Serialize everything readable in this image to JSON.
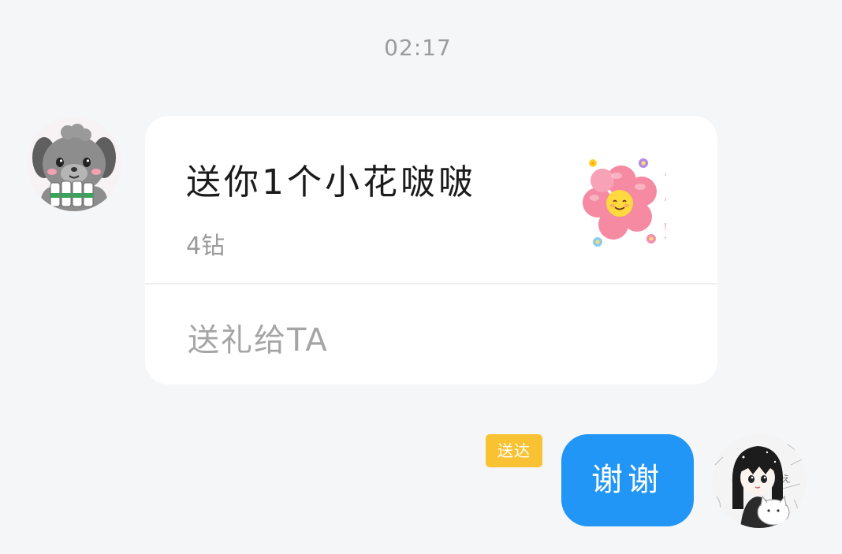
{
  "chat": {
    "timestamp": "02:17",
    "received_message": {
      "sender_avatar": "gray-puppy-avatar",
      "gift_card": {
        "title": "送你1个小花啵啵",
        "price": "4钻",
        "gift_image": "pink-flower-sticker",
        "gift_image_text": "棒棒！",
        "action_label": "送礼给TA"
      }
    },
    "sent_message": {
      "status_badge": "送达",
      "text": "谢谢",
      "sender_avatar": "anime-girl-avatar"
    }
  },
  "colors": {
    "background": "#f5f6f8",
    "my_bubble": "#2196f6",
    "status_badge": "#f8c232"
  }
}
